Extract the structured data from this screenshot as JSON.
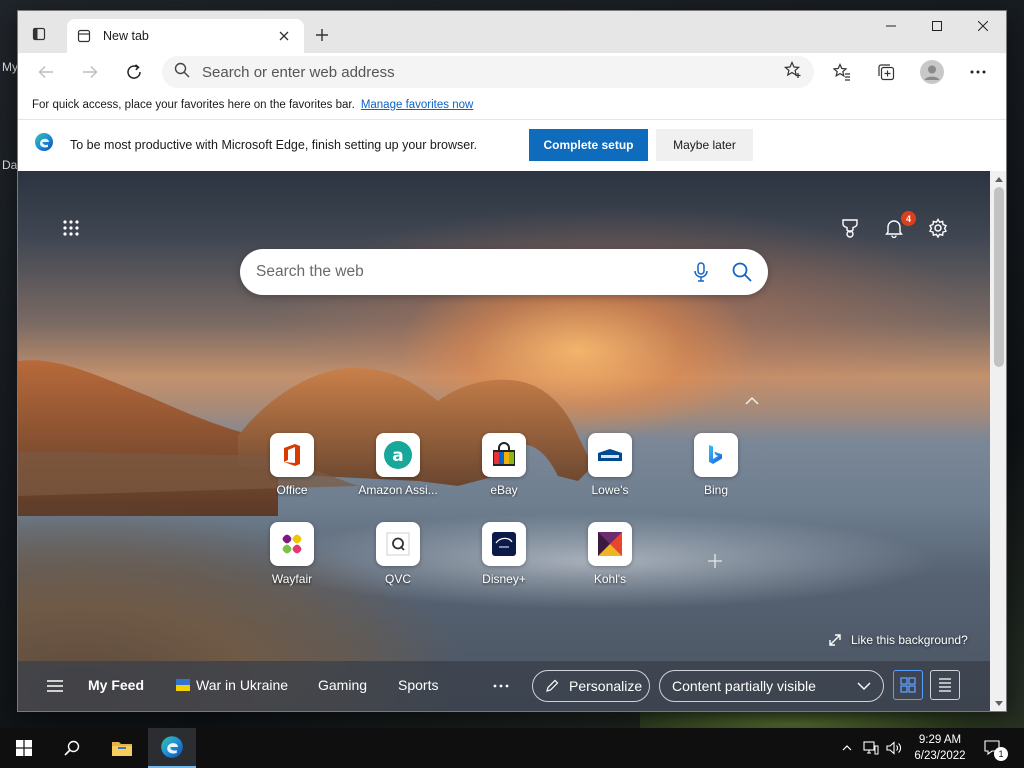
{
  "desktop": {
    "labels": [
      "My",
      "Da"
    ]
  },
  "browser": {
    "tab_title": "New tab",
    "address_placeholder": "Search or enter web address",
    "favorites_bar": {
      "text": "For quick access, place your favorites here on the favorites bar.",
      "link": "Manage favorites now"
    },
    "setup_banner": {
      "text": "To be most productive with Microsoft Edge, finish setting up your browser.",
      "primary_button": "Complete setup",
      "secondary_button": "Maybe later"
    }
  },
  "newtab": {
    "search_placeholder": "Search the web",
    "notifications_count": "4",
    "quick_links": [
      {
        "label": "Office"
      },
      {
        "label": "Amazon Assi..."
      },
      {
        "label": "eBay"
      },
      {
        "label": "Lowe's"
      },
      {
        "label": "Bing"
      },
      {
        "label": "Wayfair"
      },
      {
        "label": "QVC"
      },
      {
        "label": "Disney+"
      },
      {
        "label": "Kohl's"
      }
    ],
    "like_background": "Like this background?",
    "feed": {
      "items": [
        "My Feed",
        "War in Ukraine",
        "Gaming",
        "Sports"
      ],
      "personalize": "Personalize",
      "content_select": "Content partially visible"
    }
  },
  "taskbar": {
    "time": "9:29 AM",
    "date": "6/23/2022",
    "notification_count": "1"
  },
  "colors": {
    "accent": "#0f6cbd",
    "link": "#0b63c5",
    "badge": "#d9411e"
  }
}
